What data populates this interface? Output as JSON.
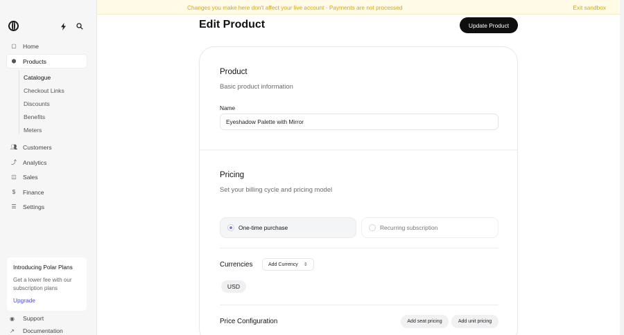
{
  "banner": {
    "message": "Changes you make here don't affect your live account · Payments are not processed",
    "exit": "Exit sandbox"
  },
  "sidebar": {
    "logo_icon": "polar-logo-icon",
    "top_icons": [
      "bolt-icon",
      "search-icon"
    ],
    "nav": [
      {
        "label": "Home",
        "icon": "home-icon"
      },
      {
        "label": "Products",
        "icon": "box-icon",
        "active": true
      },
      {
        "label": "Customers",
        "icon": "users-icon"
      },
      {
        "label": "Analytics",
        "icon": "trend-icon"
      },
      {
        "label": "Sales",
        "icon": "bag-icon"
      },
      {
        "label": "Finance",
        "icon": "dollar-icon"
      },
      {
        "label": "Settings",
        "icon": "sliders-icon"
      }
    ],
    "sub_items": [
      "Catalogue",
      "Checkout Links",
      "Discounts",
      "Benefits",
      "Meters"
    ],
    "promo": {
      "title": "Introducing Polar Plans",
      "text": "Get a lower fee with our subscription plans",
      "link": "Upgrade"
    },
    "bottom": [
      {
        "label": "Support",
        "icon": "help-icon"
      },
      {
        "label": "Documentation",
        "icon": "external-link-icon"
      }
    ]
  },
  "header": {
    "title": "Edit Product",
    "update_button": "Update Product"
  },
  "product_section": {
    "title": "Product",
    "subtitle": "Basic product information",
    "name_label": "Name",
    "name_value": "Eyeshadow Palette with Mirror"
  },
  "pricing_section": {
    "title": "Pricing",
    "subtitle": "Set your billing cycle and pricing model",
    "options": [
      {
        "label": "One-time purchase",
        "selected": true
      },
      {
        "label": "Recurring subscription",
        "selected": false
      }
    ],
    "currencies_label": "Currencies",
    "add_currency": "Add Currency",
    "currency": "USD",
    "price_config_label": "Price Configuration",
    "add_seat_pricing": "Add seat pricing",
    "add_unit_pricing": "Add unit pricing"
  },
  "colors": {
    "banner_text": "#d4a51a",
    "banner_bg": "#fffbe6",
    "accent": "#4a4bd6",
    "primary_button": "#0f0f10"
  }
}
